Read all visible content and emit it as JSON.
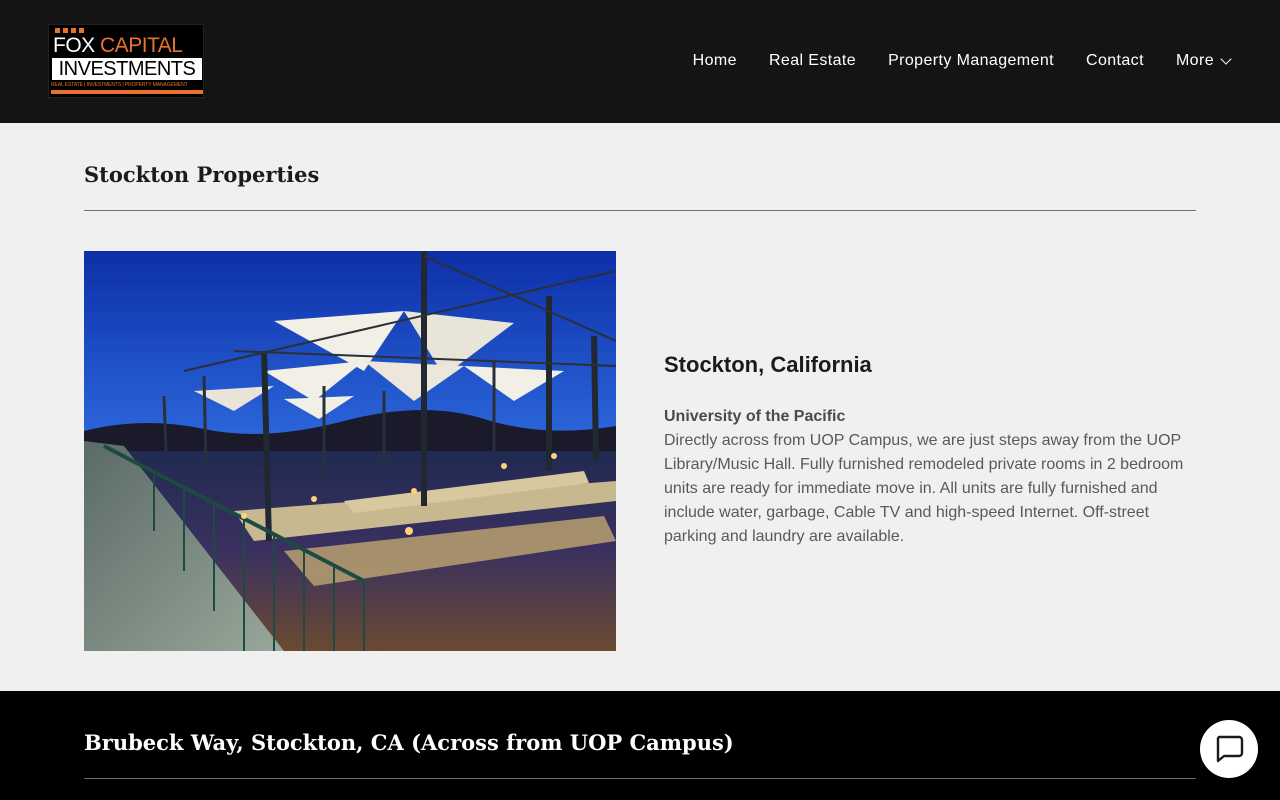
{
  "header": {
    "logo": {
      "line1_a": "FOX",
      "line1_b": "CAPITAL",
      "line2": "INVESTMENTS",
      "tagline": "REAL ESTATE | INVESTMENTS | PROPERTY MANAGEMENT"
    },
    "nav": [
      {
        "label": "Home"
      },
      {
        "label": "Real Estate"
      },
      {
        "label": "Property Management"
      },
      {
        "label": "Contact"
      },
      {
        "label": "More"
      }
    ]
  },
  "main": {
    "section_title": "Stockton Properties",
    "location": {
      "heading": "Stockton, California",
      "subheading": "University of the Pacific",
      "body": "Directly across from UOP Campus, we are just steps away from the UOP Library/Music Hall.  Fully furnished remodeled private rooms in 2 bedroom units are ready for immediate move in.  All units are fully furnished and include water, garbage, Cable TV and high-speed Internet.  Off-street parking and laundry are available."
    }
  },
  "dark_section": {
    "title": "Brubeck Way, Stockton, CA (Across from UOP Campus)"
  },
  "colors": {
    "accent": "#e8742c",
    "header_bg": "#141414",
    "page_bg": "#f0f0f0"
  },
  "icons": {
    "chat": "chat-bubble-icon",
    "more": "chevron-down-icon"
  }
}
